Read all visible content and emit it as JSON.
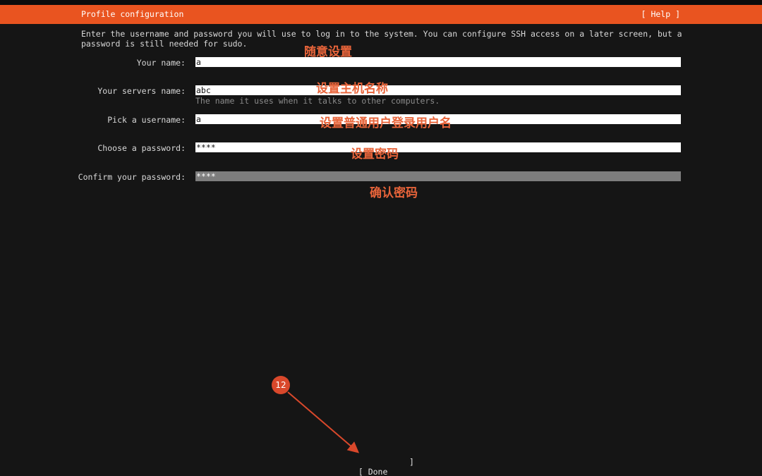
{
  "header": {
    "title": "Profile configuration",
    "help": "[ Help ]",
    "accent_color": "#e95420"
  },
  "intro": "Enter the username and password you will use to log in to the system. You can configure SSH access on a later screen, but a password is still needed for sudo.",
  "form": {
    "name": {
      "label": "Your name:",
      "value": "a"
    },
    "server": {
      "label": "Your servers name:",
      "value": "abc",
      "hint": "The name it uses when it talks to other computers."
    },
    "username": {
      "label": "Pick a username:",
      "value": "a"
    },
    "password": {
      "label": "Choose a password:",
      "value": "****"
    },
    "confirm": {
      "label": "Confirm your password:",
      "value": "****"
    }
  },
  "annotations": {
    "name": "随意设置",
    "server": "设置主机名称",
    "username": "设置普通用户登录用户名",
    "password": "设置密码",
    "confirm": "确认密码",
    "step_badge": "12",
    "color": "#e8643a"
  },
  "footer": {
    "done_label": "[ Done",
    "done_bracket": "]"
  }
}
